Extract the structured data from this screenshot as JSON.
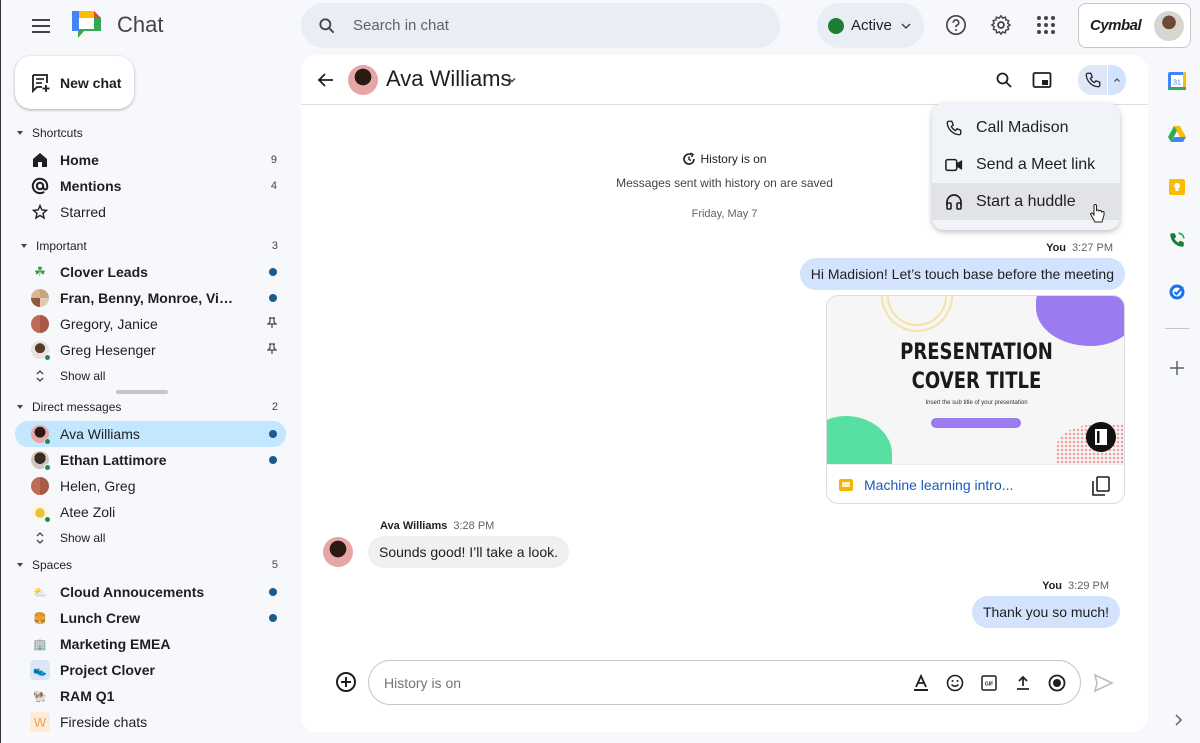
{
  "app": {
    "title": "Chat"
  },
  "search": {
    "placeholder": "Search in chat"
  },
  "status": {
    "label": "Active",
    "color": "#1e7e34"
  },
  "account": {
    "org": "Cymbal"
  },
  "new_chat": {
    "label": "New chat"
  },
  "sidebar": {
    "shortcuts": {
      "label": "Shortcuts",
      "items": [
        {
          "label": "Home",
          "count": "9",
          "bold": true,
          "icon": "home-icon"
        },
        {
          "label": "Mentions",
          "count": "4",
          "bold": true,
          "icon": "at-icon"
        },
        {
          "label": "Starred",
          "count": "",
          "bold": false,
          "icon": "star-icon"
        }
      ]
    },
    "important": {
      "label": "Important",
      "count": "3",
      "items": [
        {
          "label": "Clover Leads",
          "bold": true,
          "right": "unread"
        },
        {
          "label": "Fran, Benny, Monroe, Vin...",
          "bold": true,
          "right": "unread"
        },
        {
          "label": "Gregory, Janice",
          "bold": false,
          "right": "pin"
        },
        {
          "label": "Greg Hesenger",
          "bold": false,
          "right": "pin"
        }
      ],
      "show_all": "Show all"
    },
    "direct_messages": {
      "label": "Direct messages",
      "count": "2",
      "items": [
        {
          "label": "Ava Williams",
          "bold": false,
          "right": "unread",
          "selected": true
        },
        {
          "label": "Ethan Lattimore",
          "bold": true,
          "right": "unread"
        },
        {
          "label": "Helen, Greg",
          "bold": false,
          "right": ""
        },
        {
          "label": "Atee Zoli",
          "bold": false,
          "right": ""
        }
      ],
      "show_all": "Show all"
    },
    "spaces": {
      "label": "Spaces",
      "count": "5",
      "items": [
        {
          "label": "Cloud Annoucements",
          "bold": true,
          "right": "unread",
          "emoji": "⛅"
        },
        {
          "label": "Lunch Crew",
          "bold": true,
          "right": "unread",
          "emoji": "🍔"
        },
        {
          "label": "Marketing EMEA",
          "bold": true,
          "right": "",
          "emoji": "🏢"
        },
        {
          "label": "Project Clover",
          "bold": true,
          "right": "",
          "emoji": "👟"
        },
        {
          "label": "RAM Q1",
          "bold": true,
          "right": "",
          "emoji": "🐏"
        },
        {
          "label": "Fireside chats",
          "bold": false,
          "right": "",
          "emoji": "W"
        }
      ]
    }
  },
  "chat": {
    "contact_name": "Ava Williams",
    "history_title": "History is on",
    "history_sub": "Messages sent with history on are saved",
    "date_separator": "Friday, May 7",
    "messages": [
      {
        "sender": "You",
        "time": "3:27 PM",
        "text": "Hi Madision! Let’s touch base before the meeting"
      },
      {
        "sender": "Ava Williams",
        "time": "3:28 PM",
        "text": "Sounds good! I’ll take a look."
      },
      {
        "sender": "You",
        "time": "3:29 PM",
        "text": "Thank you so much!"
      }
    ],
    "attachment": {
      "name": "Machine learning intro...",
      "slide_title_line1": "PRESENTATION",
      "slide_title_line2": "COVER TITLE",
      "slide_subtitle": "Insert the sub title of your presentation"
    },
    "composer_placeholder": "History is on"
  },
  "call_menu": {
    "items": [
      {
        "label": "Call Madison",
        "icon": "phone-icon"
      },
      {
        "label": "Send a Meet link",
        "icon": "video-icon"
      },
      {
        "label": "Start a huddle",
        "icon": "headphones-icon",
        "hovered": true
      }
    ]
  },
  "right_rail": {
    "apps": [
      "Calendar",
      "Drive",
      "Keep",
      "Voice",
      "Tasks"
    ],
    "calendar_day": "31"
  }
}
